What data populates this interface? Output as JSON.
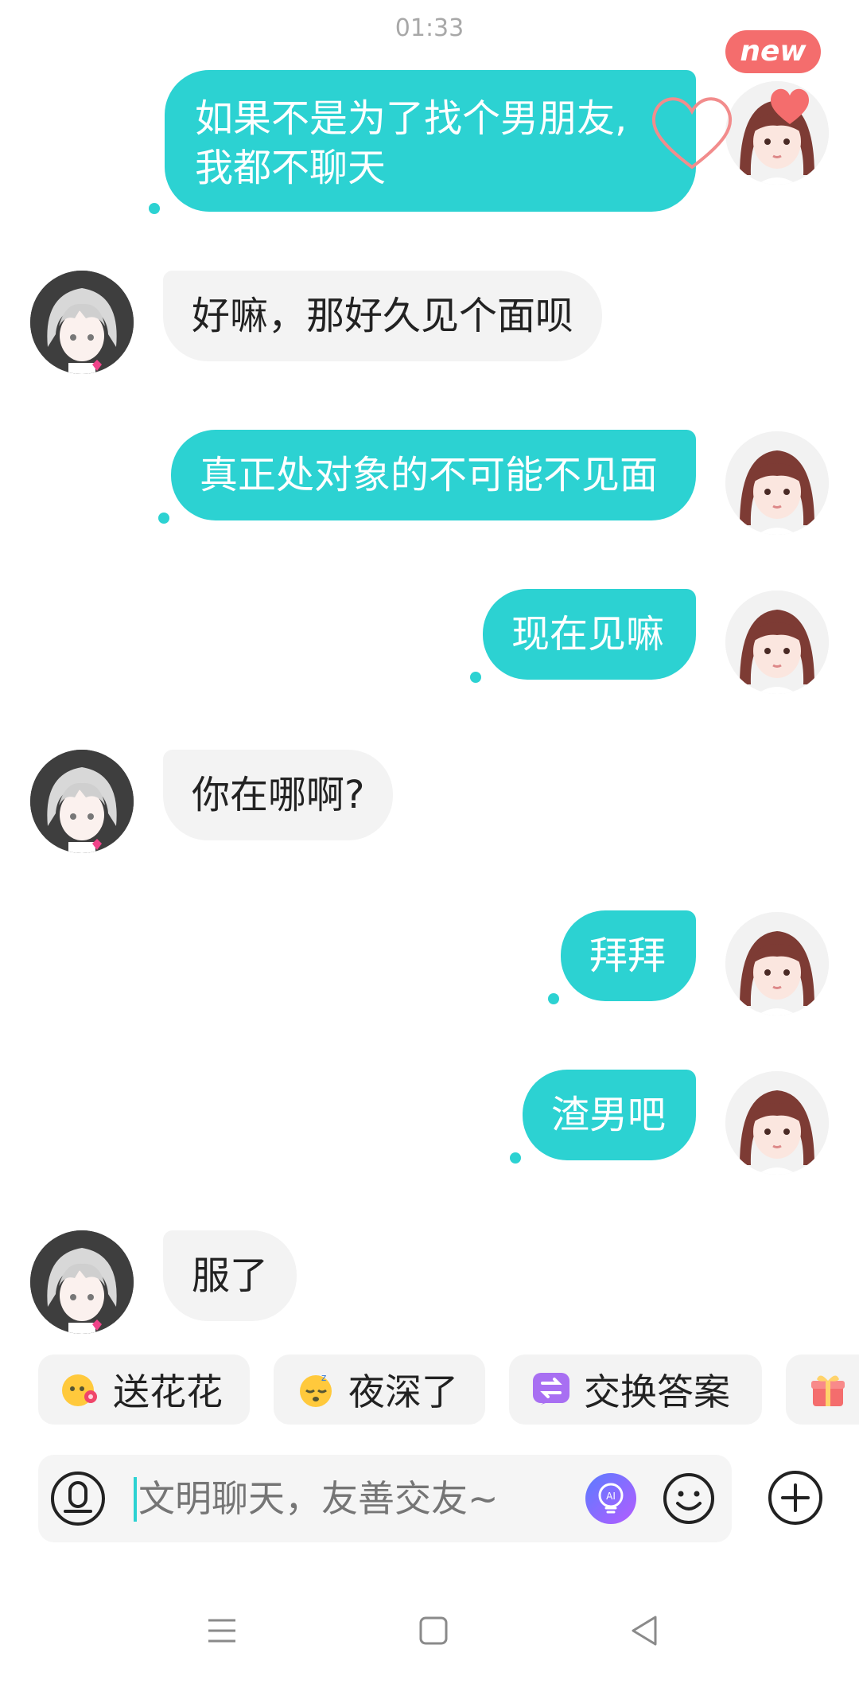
{
  "status": {
    "time": "01:33"
  },
  "badge": "new",
  "messages": [
    {
      "side": "out",
      "text_lines": [
        "如果不是为了找个男朋友,",
        "我都不聊天"
      ]
    },
    {
      "side": "in",
      "text": "好嘛，那好久见个面呗"
    },
    {
      "side": "out",
      "text": "真正处对象的不可能不见面"
    },
    {
      "side": "out",
      "text": "现在见嘛"
    },
    {
      "side": "in",
      "text": "你在哪啊?"
    },
    {
      "side": "out",
      "text": "拜拜"
    },
    {
      "side": "out",
      "text": "渣男吧"
    },
    {
      "side": "in",
      "text": "服了"
    }
  ],
  "quick_replies": [
    {
      "label": "送花花",
      "icon": "flower-emoji-icon"
    },
    {
      "label": "夜深了",
      "icon": "sleepy-emoji-icon"
    },
    {
      "label": "交换答案",
      "icon": "exchange-icon"
    },
    {
      "label": "",
      "icon": "gift-icon"
    }
  ],
  "composer": {
    "placeholder": "文明聊天，友善交友~",
    "mic_icon": "mic-icon",
    "ai_icon": "ai-bulb-icon",
    "emoji_icon": "smile-icon",
    "plus_icon": "plus-icon"
  },
  "nav": [
    "menu-icon",
    "home-icon",
    "back-icon"
  ],
  "colors": {
    "outgoing_bubble": "#2cd2d2",
    "incoming_bubble": "#f3f3f3",
    "badge": "#f46d6d",
    "heart": "#f46d6d"
  }
}
